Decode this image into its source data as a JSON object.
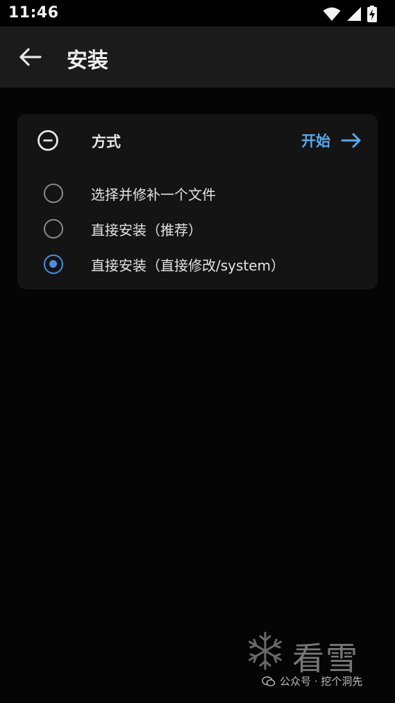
{
  "status_bar": {
    "time": "11:46",
    "icons": [
      "wifi-icon",
      "signal-icon",
      "battery-charging-icon"
    ]
  },
  "app_bar": {
    "back_icon": "arrow-left-icon",
    "title": "安装"
  },
  "card": {
    "header_icon": "minus-circle-icon",
    "title": "方式",
    "start_label": "开始",
    "start_icon": "arrow-right-icon",
    "accent_color": "#58a9f2",
    "options": [
      {
        "label": "选择并修补一个文件",
        "checked": false
      },
      {
        "label": "直接安装（推荐）",
        "checked": false
      },
      {
        "label": "直接安装（直接修改/system）",
        "checked": true
      }
    ]
  },
  "watermark": {
    "brand": "看雪",
    "caption": "公众号 · 挖个洞先",
    "icons": [
      "snowflake-icon",
      "wechat-icon"
    ]
  }
}
